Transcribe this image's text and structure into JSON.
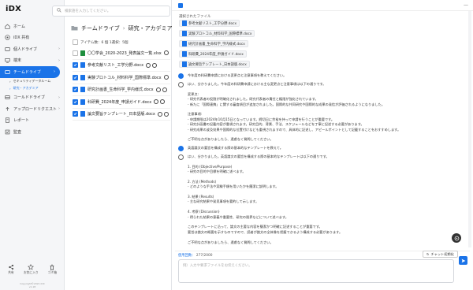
{
  "app": {
    "logo": "iDX"
  },
  "sidebar": {
    "items": [
      {
        "label": "ホーム",
        "icon": "home-icon"
      },
      {
        "label": "iDX 共有",
        "icon": "share-icon"
      },
      {
        "label": "個人ドライブ",
        "icon": "drive-icon",
        "chev": true
      },
      {
        "label": "端末",
        "icon": "device-icon",
        "chev": true
      },
      {
        "label": "チームドライブ",
        "icon": "team-drive-icon",
        "chev": true,
        "active": true
      }
    ],
    "subitems": [
      {
        "label": "セキュリティデータルーム"
      },
      {
        "label": "研究・アカデミア",
        "selected": true
      }
    ],
    "items2": [
      {
        "label": "コールドドライブ",
        "icon": "cold-drive-icon",
        "chev": true
      },
      {
        "label": "アップロードリクエスト",
        "icon": "upload-request-icon",
        "chev": true
      },
      {
        "label": "レポート",
        "icon": "report-icon"
      },
      {
        "label": "監査",
        "icon": "audit-icon"
      }
    ],
    "bottom": [
      {
        "label": "共有",
        "icon": "share-link-icon"
      },
      {
        "label": "お気に入り",
        "icon": "star-icon"
      },
      {
        "label": "ゴミ箱",
        "icon": "trash-icon"
      }
    ],
    "copyright": "Copyright©2021 iDX\nv1.18"
  },
  "files": {
    "search_placeholder": "検索語を入力してください。",
    "breadcrumb": [
      "チームドライブ",
      "研究・アカデミア"
    ],
    "count_label": "アイテム数：6 個 1選択：5個",
    "rows": [
      {
        "name": "〇〇学会_2020-2023_発表論文一覧.xlsx",
        "checked": false,
        "type": "xlsx"
      },
      {
        "name": "参考文献リスト_工学分野.docx",
        "checked": true,
        "type": "docx"
      },
      {
        "name": "実験プロトコル_材料科学_国際標準.docx",
        "checked": true,
        "type": "docx"
      },
      {
        "name": "研究計画書_生命科学_学内様式.docx",
        "checked": true,
        "type": "docx"
      },
      {
        "name": "科研費_2024年度_申請ガイド.docx",
        "checked": true,
        "type": "docx"
      },
      {
        "name": "論文要旨テンプレート_日本語版.docx",
        "checked": true,
        "type": "docx"
      }
    ]
  },
  "panel": {
    "selected_label": "選択されたファイル",
    "chips": [
      "参考文献リスト_工学分野.docx",
      "実験プロトコル_材料科学_国際標準.docx",
      "研究計画書_生命科学_学内様式.docx",
      "科研費_2024年度_申請ガイド.docx",
      "論文要旨テンプレート_日本語版.docx"
    ],
    "messages": [
      {
        "role": "user",
        "lines": [
          "今年度の科研費申請における変更点と注意事項を教えてください。"
        ]
      },
      {
        "role": "bot",
        "lines": [
          "はい、分かりました。今年度の科研費申請における主な変更点と注意事項は以下の通りです。",
          "",
          "変更点:",
          "- 研究代表者の役割が明確化されました。研究代表者の責任と権限が強化されています。",
          "- 新たに「国際連携」に関する審査項目が追加されました。国際的な共同研究や国際的な成果の発信が評価されるようになりました。",
          "",
          "注意事項:",
          "- 申請期限は2024年10月15日となっています。締切日に余裕を持って申請を行うことが重要です。",
          "- 研究計画書の記載内容が重視されます。研究目的、背景、手法、スケジュールなどを丁寧に記述する必要があります。",
          "- 研究成果の波及効果や国際的な位置付けなども重視されますので、具体的に記述し、アピールポイントとして記載することをおすすめします。",
          "",
          "ご不明な点がありましたら、遠慮なく質問してください。"
        ]
      },
      {
        "role": "user",
        "lines": [
          "英語論文の要旨を構成する際の基本的なテンプレートを教えて。"
        ]
      },
      {
        "role": "bot",
        "lines": [
          "はい、分かりました。英語論文の要旨を構成する際の基本的なテンプレートは以下の通りです。",
          "",
          "1. 目的 (Objective/Purpose)",
          "- 研究の目的や目標を明確に述べます。",
          "",
          "2. 方法 (Methods)",
          "- どのような手法や実験手順を用いたかを簡潔に説明します。",
          "",
          "3. 結果 (Results)",
          "- 主な研究結果や発見事項を要約して示します。",
          "",
          "4. 考察 (Discussion)",
          "- 得られた結果の意義や重要性、研究の限界などについて述べます。",
          "",
          "このテンプレートに沿って、論文の主要な内容を簡潔かつ明確に記述することが重要です。",
          "要旨は論文の概要を示すものですので、読者が論文の全体像を把握できるよう構成する必要があります。",
          "",
          "ご不明な点がありましたら、遠慮なく質問してください。"
        ]
      }
    ],
    "usage_label": "使用回数：",
    "usage_value": "277/2000",
    "reset_label": "チャット初期化",
    "input_placeholder": "例）入力や要求ファイルをお伝えください。"
  },
  "colors": {
    "accent": "#1a73e8",
    "sidebar_bg": "#f5f6f8"
  }
}
